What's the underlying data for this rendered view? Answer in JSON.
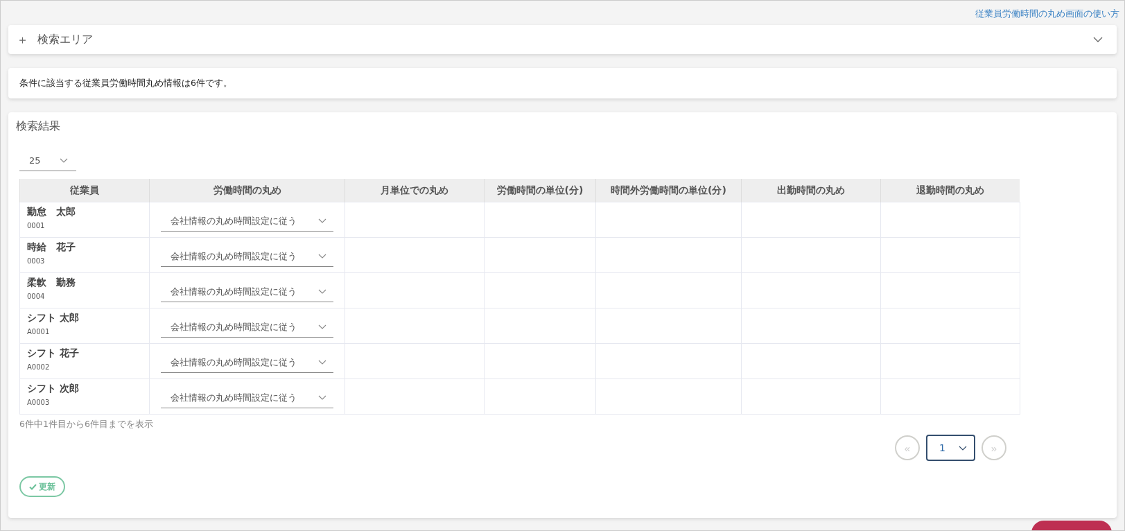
{
  "help_link": "従業員労働時間の丸め画面の使い方",
  "search_area": {
    "icon": "＋",
    "title": "検索エリア",
    "expanded": false
  },
  "result_message": "条件に該当する従業員労働時間丸め情報は6件です。",
  "results": {
    "title": "検索結果",
    "page_size": "25",
    "table": {
      "columns": [
        "従業員",
        "労働時間の丸め",
        "月単位での丸め",
        "労働時間の単位(分)",
        "時間外労働時間の単位(分)",
        "出勤時間の丸め",
        "退勤時間の丸め"
      ],
      "rows": [
        {
          "name": "勤怠　太郎",
          "code": "0001",
          "rounding": "会社情報の丸め時間設定に従う"
        },
        {
          "name": "時給　花子",
          "code": "0003",
          "rounding": "会社情報の丸め時間設定に従う"
        },
        {
          "name": "柔軟　勤務",
          "code": "0004",
          "rounding": "会社情報の丸め時間設定に従う"
        },
        {
          "name": "シフト 太郎",
          "code": "A0001",
          "rounding": "会社情報の丸め時間設定に従う"
        },
        {
          "name": "シフト 花子",
          "code": "A0002",
          "rounding": "会社情報の丸め時間設定に従う"
        },
        {
          "name": "シフト 次郎",
          "code": "A0003",
          "rounding": "会社情報の丸め時間設定に従う"
        }
      ]
    },
    "range_text": "6件中1件目から6件目までを表示",
    "pagination": {
      "prev": "«",
      "page": "1",
      "next": "»"
    },
    "update_button": "更新"
  }
}
